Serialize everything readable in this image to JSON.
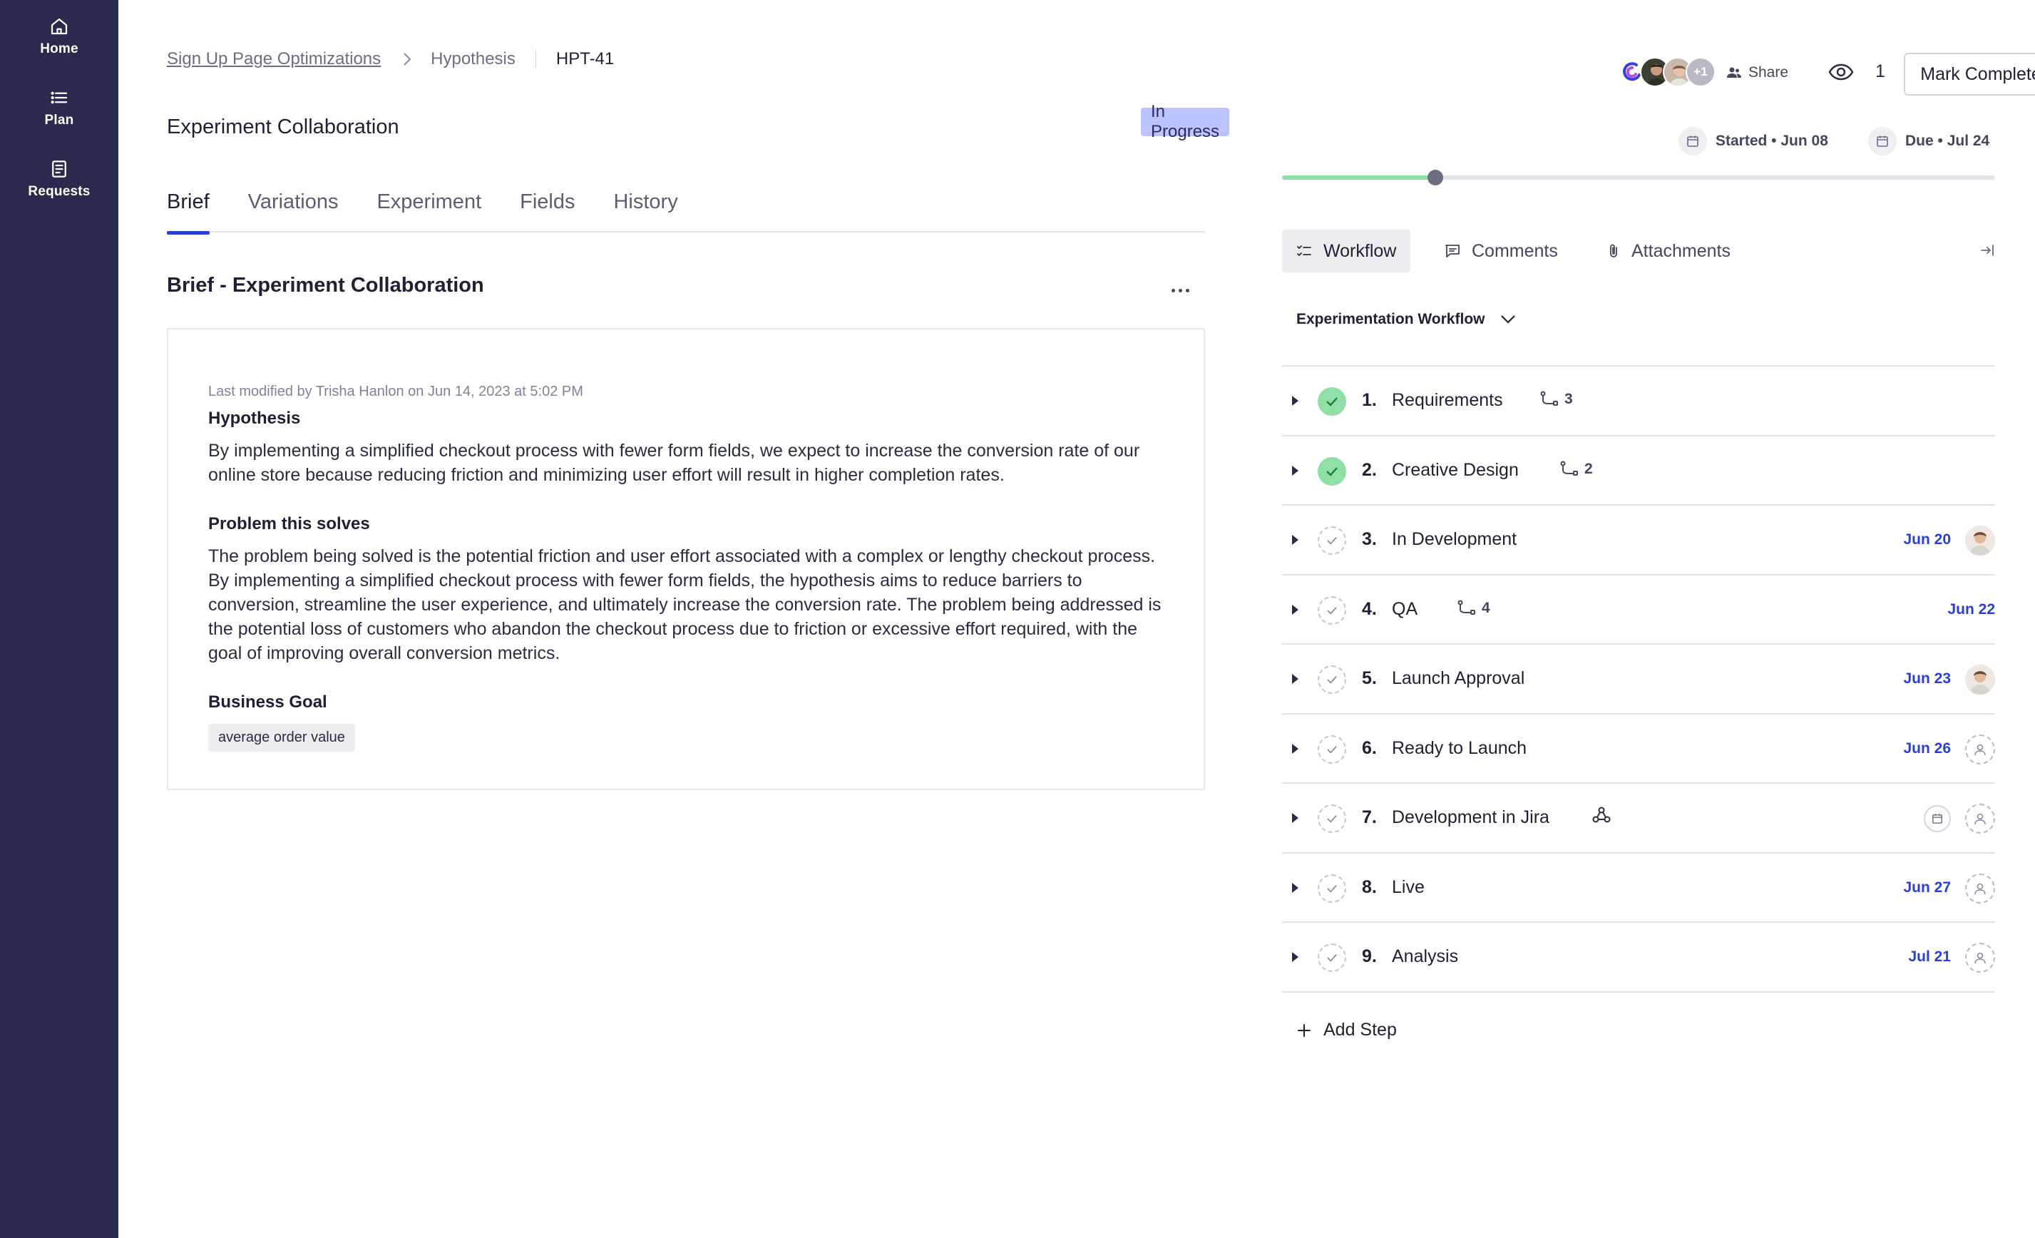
{
  "sidebar": {
    "items": [
      {
        "label": "Home",
        "icon": "home-icon"
      },
      {
        "label": "Plan",
        "icon": "list-icon"
      },
      {
        "label": "Requests",
        "icon": "document-icon"
      }
    ]
  },
  "breadcrumb": {
    "project": "Sign Up Page Optimizations",
    "type": "Hypothesis",
    "id": "HPT-41"
  },
  "page": {
    "title": "Experiment Collaboration",
    "status": "In Progress"
  },
  "tabs": [
    {
      "label": "Brief",
      "active": true
    },
    {
      "label": "Variations",
      "active": false
    },
    {
      "label": "Experiment",
      "active": false
    },
    {
      "label": "Fields",
      "active": false
    },
    {
      "label": "History",
      "active": false
    }
  ],
  "brief": {
    "section_title": "Brief - Experiment Collaboration",
    "last_modified": "Last modified by Trisha Hanlon on Jun 14, 2023 at 5:02 PM",
    "hypothesis_label": "Hypothesis",
    "hypothesis_text": "By implementing a simplified checkout process with fewer form fields, we expect to increase the conversion rate of our online store because reducing friction and minimizing user effort will result in higher completion rates.",
    "problem_label": "Problem this solves",
    "problem_text": "The problem being solved is the potential friction and user effort associated with a complex or lengthy checkout process. By implementing a simplified checkout process with fewer form fields, the hypothesis aims to reduce barriers to conversion, streamline the user experience, and ultimately increase the conversion rate. The problem being addressed is the potential loss of customers who abandon the checkout process due to friction or excessive effort required, with the goal of improving overall conversion metrics.",
    "goal_label": "Business Goal",
    "goal_tag": "average order value"
  },
  "header": {
    "avatars_more": "+1",
    "share_label": "Share",
    "watchers": "1",
    "mark_complete": "Mark Complete",
    "started": "Started • Jun 08",
    "due": "Due • Jul 24",
    "progress_fraction": 0.215
  },
  "right_tabs": [
    {
      "label": "Workflow",
      "active": true
    },
    {
      "label": "Comments",
      "active": false
    },
    {
      "label": "Attachments",
      "active": false
    }
  ],
  "workflow": {
    "title": "Experimentation Workflow",
    "add_step": "Add Step",
    "steps": [
      {
        "num": "1.",
        "label": "Requirements",
        "done": true,
        "subtasks": "3",
        "due": "",
        "assignee": "none"
      },
      {
        "num": "2.",
        "label": "Creative Design",
        "done": true,
        "subtasks": "2",
        "due": "",
        "assignee": "none"
      },
      {
        "num": "3.",
        "label": "In Development",
        "done": false,
        "subtasks": "",
        "due": "Jun 20",
        "assignee": "photo"
      },
      {
        "num": "4.",
        "label": "QA",
        "done": false,
        "subtasks": "4",
        "due": "Jun 22",
        "assignee": "none"
      },
      {
        "num": "5.",
        "label": "Launch Approval",
        "done": false,
        "subtasks": "",
        "due": "Jun 23",
        "assignee": "photo"
      },
      {
        "num": "6.",
        "label": "Ready to Launch",
        "done": false,
        "subtasks": "",
        "due": "Jun 26",
        "assignee": "empty"
      },
      {
        "num": "7.",
        "label": "Development in Jira",
        "done": false,
        "subtasks": "",
        "due": "",
        "assignee": "empty",
        "integration": "webhook-icon"
      },
      {
        "num": "8.",
        "label": "Live",
        "done": false,
        "subtasks": "",
        "due": "Jun 27",
        "assignee": "empty"
      },
      {
        "num": "9.",
        "label": "Analysis",
        "done": false,
        "subtasks": "",
        "due": "Jul 21",
        "assignee": "empty"
      }
    ]
  },
  "colors": {
    "sidebar_bg": "#2a2a4e",
    "accent": "#2b3fd6",
    "status_badge": "#bcc3ff",
    "done_green": "#8fe0a6"
  }
}
